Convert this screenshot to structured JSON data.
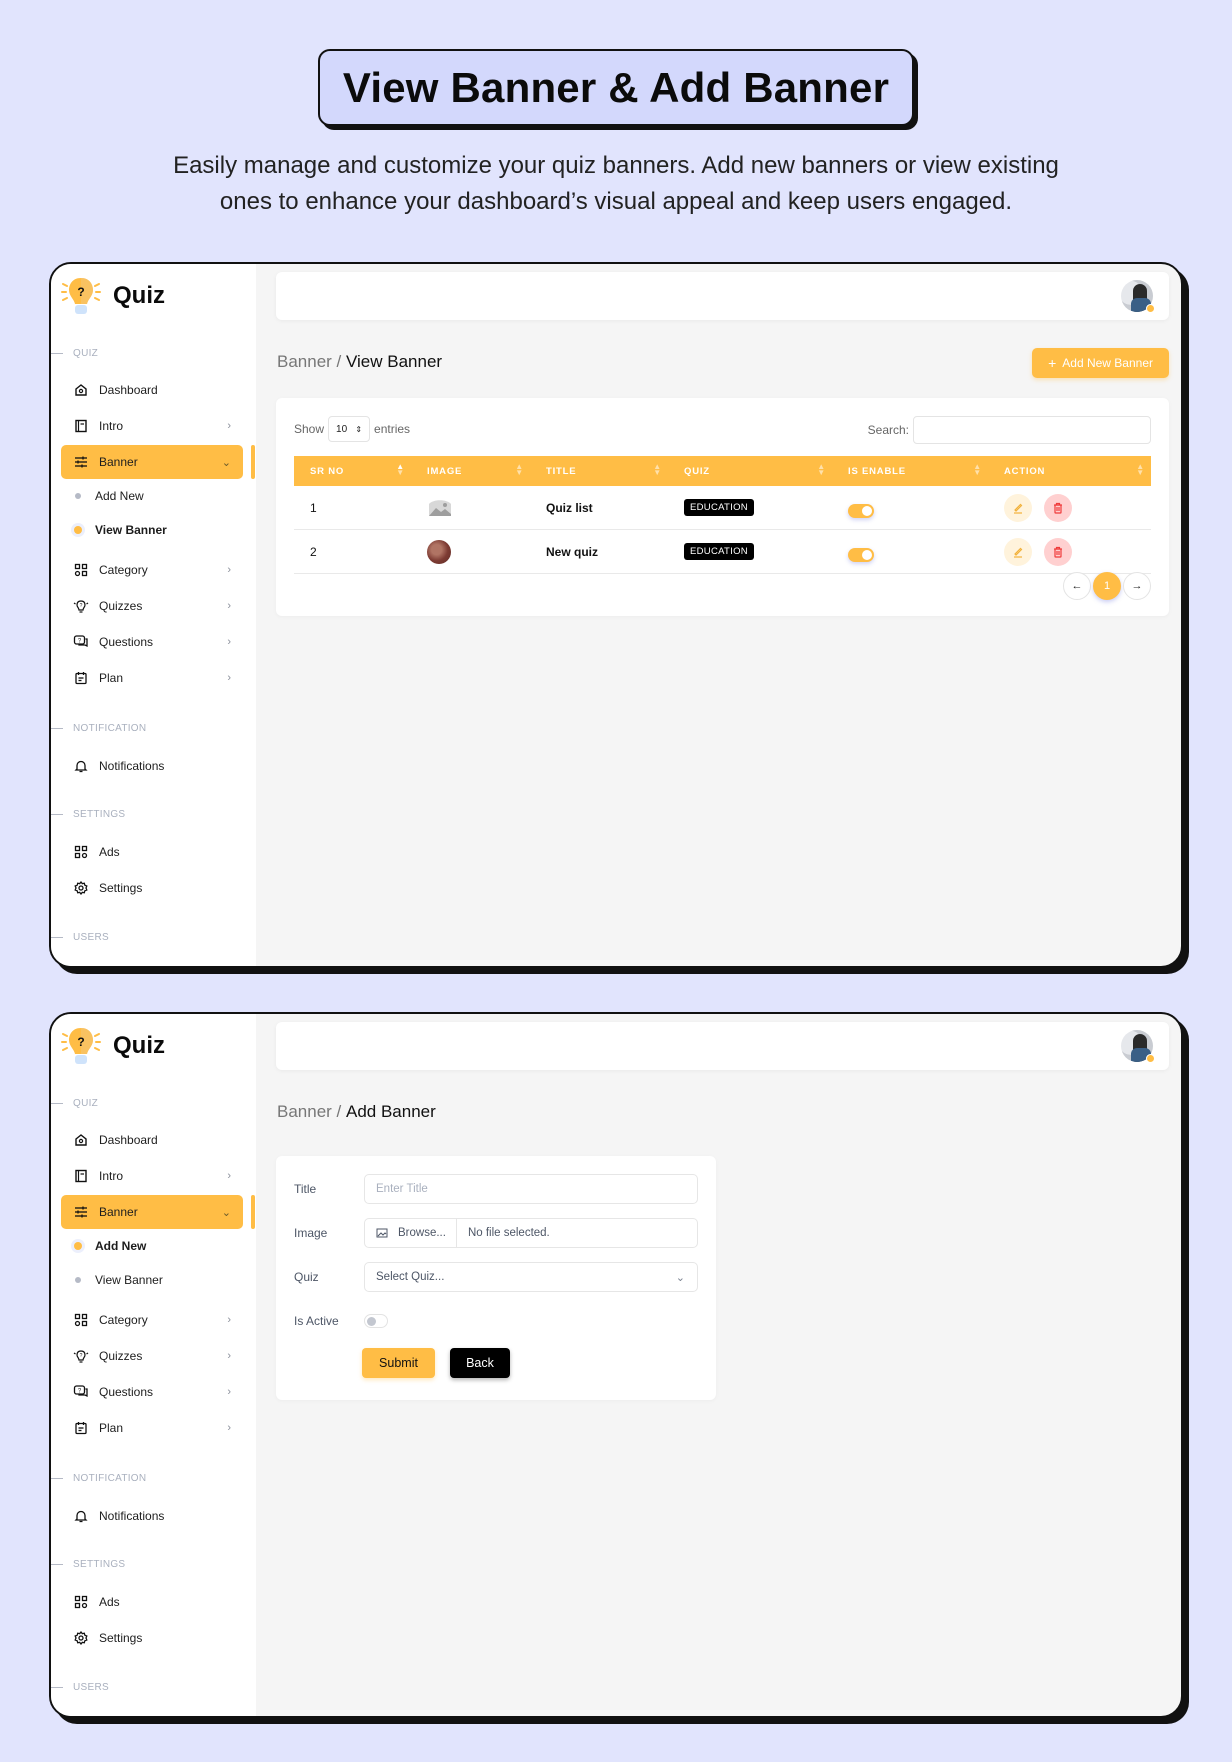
{
  "hero": {
    "title": "View Banner & Add Banner",
    "subtitle_line1": "Easily manage and customize your quiz banners. Add new banners or view existing",
    "subtitle_line2": "ones to enhance your dashboard’s visual appeal and keep users engaged."
  },
  "colors": {
    "accent": "#ffbd45",
    "background": "#e1e4fd",
    "hero_box": "#d3d8fc",
    "danger": "#ffd0d0",
    "badge": "#000000"
  },
  "sidebar": {
    "app_name": "Quiz",
    "sections": {
      "quiz": "QUIZ",
      "notification": "NOTIFICATION",
      "settings": "SETTINGS",
      "users": "USERS"
    },
    "items": {
      "dashboard": "Dashboard",
      "intro": "Intro",
      "banner": "Banner",
      "add_new": "Add New",
      "view_banner": "View Banner",
      "category": "Category",
      "quizzes": "Quizzes",
      "questions": "Questions",
      "plan": "Plan",
      "notifications": "Notifications",
      "ads": "Ads",
      "settings": "Settings"
    }
  },
  "view_page": {
    "breadcrumb_parent": "Banner /",
    "breadcrumb_current": "View Banner",
    "add_button": "Add New Banner",
    "show_label": "Show",
    "entries_value": "10",
    "entries_label": "entries",
    "search_label": "Search:",
    "search_value": "",
    "columns": [
      "SR NO",
      "IMAGE",
      "TITLE",
      "QUIZ",
      "IS ENABLE",
      "ACTION"
    ],
    "rows": [
      {
        "sr": "1",
        "image": "placeholder-image",
        "title": "Quiz list",
        "quiz": "EDUCATION",
        "enabled": true
      },
      {
        "sr": "2",
        "image": "photo-thumbnail",
        "title": "New quiz",
        "quiz": "EDUCATION",
        "enabled": true
      }
    ],
    "pagination": {
      "prev": "←",
      "current": "1",
      "next": "→"
    }
  },
  "add_page": {
    "breadcrumb_parent": "Banner /",
    "breadcrumb_current": "Add Banner",
    "fields": {
      "title_label": "Title",
      "title_placeholder": "Enter Title",
      "image_label": "Image",
      "browse_label": "Browse...",
      "file_status": "No file selected.",
      "quiz_label": "Quiz",
      "quiz_placeholder": "Select Quiz...",
      "active_label": "Is Active",
      "active_value": false
    },
    "submit": "Submit",
    "back": "Back"
  }
}
